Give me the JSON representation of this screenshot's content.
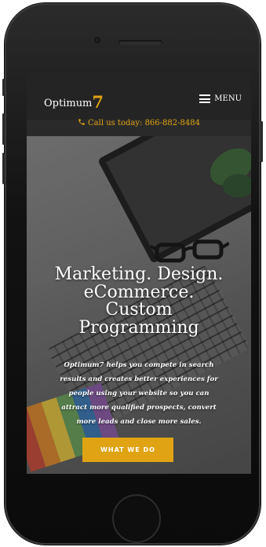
{
  "header": {
    "logo_text": "Optimum",
    "logo_number": "7",
    "menu_label": "MENU",
    "call_text": "Call us today: 866-882-8484"
  },
  "hero": {
    "headline_lines": [
      "Marketing. Design.",
      "eCommerce.",
      "Custom",
      "Programming"
    ],
    "subtext_lines": [
      "Optimum7 helps you compete in search",
      "results and creates better experiences for",
      "people using your website so you can",
      "attract more qualified prospects, convert",
      "more leads and close more sales."
    ],
    "cta_label": "WHAT WE DO"
  },
  "colors": {
    "accent": "#e0a313",
    "header_bg": "#242424",
    "text": "#ffffff"
  },
  "icons": {
    "menu": "hamburger-icon",
    "call": "phone-icon"
  }
}
